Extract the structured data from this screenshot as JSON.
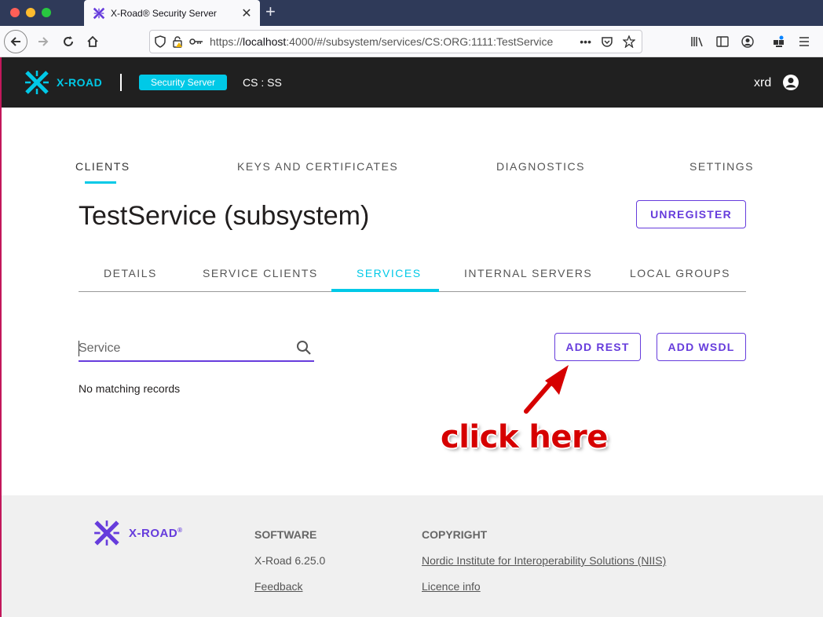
{
  "browser": {
    "tab_title": "X-Road® Security Server",
    "tab_close": "✕",
    "new_tab": "+",
    "url_prefix": "https://",
    "url_host": "localhost",
    "url_rest": ":4000/#/subsystem/services/CS:ORG:1111:TestService",
    "url_more": "•••"
  },
  "header": {
    "logo_text": "X-ROAD",
    "server_badge": "Security Server",
    "instance": "CS : SS",
    "username": "xrd"
  },
  "main_tabs": [
    {
      "label": "CLIENTS",
      "active": true
    },
    {
      "label": "KEYS AND CERTIFICATES",
      "active": false
    },
    {
      "label": "DIAGNOSTICS",
      "active": false
    },
    {
      "label": "SETTINGS",
      "active": false
    }
  ],
  "page": {
    "title": "TestService (subsystem)",
    "unregister_label": "UNREGISTER"
  },
  "sub_tabs": [
    {
      "label": "DETAILS",
      "active": false
    },
    {
      "label": "SERVICE CLIENTS",
      "active": false
    },
    {
      "label": "SERVICES",
      "active": true
    },
    {
      "label": "INTERNAL SERVERS",
      "active": false
    },
    {
      "label": "LOCAL GROUPS",
      "active": false
    }
  ],
  "services": {
    "search_placeholder": "Service",
    "search_value": "",
    "add_rest_label": "ADD REST",
    "add_wsdl_label": "ADD WSDL",
    "empty_text": "No matching records"
  },
  "annotation": {
    "text": "click here",
    "color": "#d60000"
  },
  "footer": {
    "logo_text": "X-ROAD",
    "logo_reg": "®",
    "software_heading": "SOFTWARE",
    "version": "X-Road 6.25.0",
    "feedback_link": "Feedback",
    "copyright_heading": "COPYRIGHT",
    "niis_link": "Nordic Institute for Interoperability Solutions (NIIS)",
    "licence_link": "Licence info"
  },
  "colors": {
    "accent": "#00c9e7",
    "primary": "#663cdc",
    "header_bg": "#202020"
  }
}
